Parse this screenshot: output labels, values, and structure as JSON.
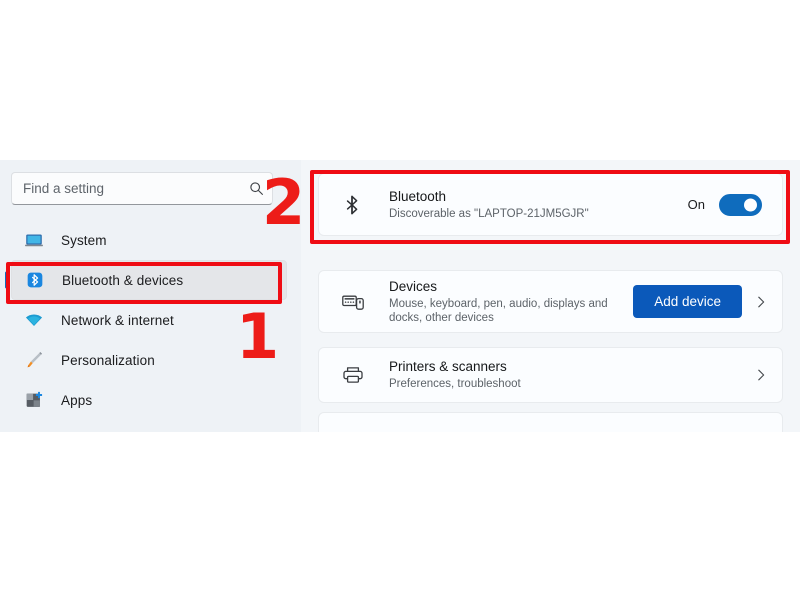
{
  "window": {
    "title": "Bluetooth & devices"
  },
  "search": {
    "placeholder": "Find a setting",
    "value": "",
    "icon": "search-icon"
  },
  "sidebar": {
    "items": [
      {
        "label": "System",
        "icon": "monitor-icon",
        "selected": false
      },
      {
        "label": "Bluetooth & devices",
        "icon": "bluetooth-icon",
        "selected": true
      },
      {
        "label": "Network & internet",
        "icon": "wifi-icon",
        "selected": false
      },
      {
        "label": "Personalization",
        "icon": "paintbrush-icon",
        "selected": false
      },
      {
        "label": "Apps",
        "icon": "apps-grid-icon",
        "selected": false
      }
    ]
  },
  "content": {
    "cards": [
      {
        "id": "bluetooth",
        "icon": "bluetooth-glyph-icon",
        "title": "Bluetooth",
        "subtitle": "Discoverable as \"LAPTOP-21JM5GJR\"",
        "toggle_state": "On",
        "toggle_on": true
      },
      {
        "id": "devices",
        "icon": "keyboard-mouse-icon",
        "title": "Devices",
        "subtitle": "Mouse, keyboard, pen, audio, displays and docks, other devices",
        "button_label": "Add device",
        "chevron": "chevron-right-icon"
      },
      {
        "id": "printers",
        "icon": "printer-icon",
        "title": "Printers & scanners",
        "subtitle": "Preferences, troubleshoot",
        "chevron": "chevron-right-icon"
      }
    ]
  },
  "annotations": {
    "step_1": "1",
    "step_2": "2",
    "color": "#ed1c18"
  },
  "colors": {
    "accent_blue": "#0f6cbd",
    "button_blue": "#0b59ba",
    "sidebar_bg": "#eef2f6",
    "content_bg": "#f3f6f9",
    "card_bg": "#fbfdff",
    "annotation_red": "#ed1c18"
  }
}
